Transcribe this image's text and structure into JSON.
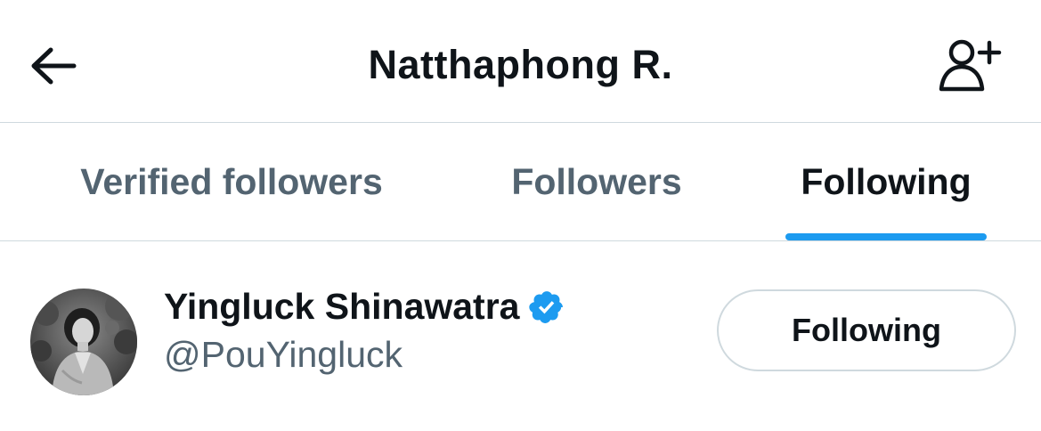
{
  "header": {
    "title": "Natthaphong R.",
    "back_icon": "arrow-left-icon",
    "add_user_icon": "person-add-icon"
  },
  "tabs": [
    {
      "label": "Verified followers",
      "active": false
    },
    {
      "label": "Followers",
      "active": false
    },
    {
      "label": "Following",
      "active": true
    }
  ],
  "accent_color": "#1d9bf0",
  "users": [
    {
      "name": "Yingluck Shinawatra",
      "handle": "@PouYingluck",
      "verified": true,
      "follow_button_label": "Following"
    }
  ]
}
